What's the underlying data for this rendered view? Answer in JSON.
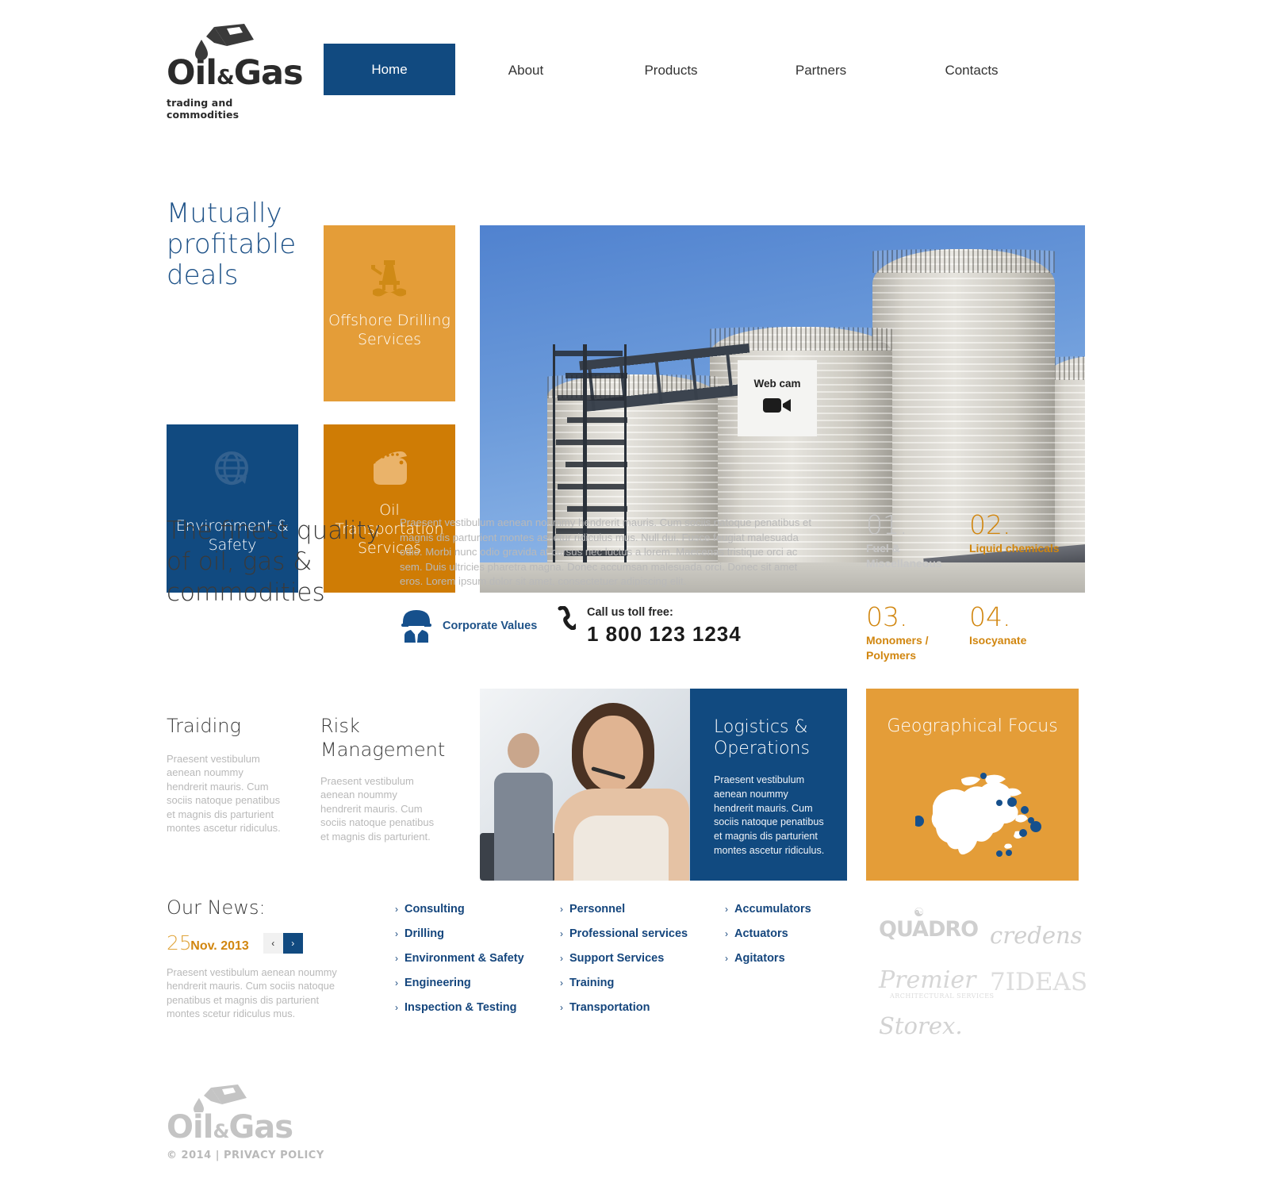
{
  "brand": {
    "name_part1": "Oil",
    "amp": "&",
    "name_part2": "Gas",
    "tagline": "trading and commodities",
    "colors": {
      "blue": "#114a80",
      "orange_light": "#e49d38",
      "orange_dark": "#cf7c05",
      "muted_text": "#b9b9b9"
    }
  },
  "nav": {
    "items": [
      {
        "label": "Home",
        "active": true
      },
      {
        "label": "About",
        "active": false
      },
      {
        "label": "Products",
        "active": false
      },
      {
        "label": "Partners",
        "active": false
      },
      {
        "label": "Contacts",
        "active": false
      }
    ]
  },
  "hero": {
    "headline": "Mutually profitable deals",
    "tiles": [
      {
        "label": "Offshore Drilling Services",
        "icon": "oil-rig-icon",
        "color": "#e49d38"
      },
      {
        "label": "Environment & Safety",
        "icon": "globe-recycle-icon",
        "color": "#114a80"
      },
      {
        "label": "Oil Transportation Services",
        "icon": "ship-icon",
        "color": "#cf7c05"
      }
    ],
    "webcam": {
      "label": "Web cam",
      "icon": "video-camera-icon"
    }
  },
  "quality": {
    "title": "The finest quality of oil, gas & commodities",
    "body": "Praesent vestibulum aenean noummy hendrerit mauris. Cum sociis natoque penatibus et magnis dis parturient montes ascetur ridiculus mus. Null dui. Fusce feugiat malesuada odio. Morbi nunc odio gravida at cursus nec luctus a lorem. Maecenas tristique orci ac sem. Duis ultricies pharetra magna. Donec accumsan malesuada orci. Donec sit amet eros. Lorem ipsum dolor sit amet, consectetuer adipiscing elit.",
    "corporate_values": "Corporate Values",
    "call_label": "Call us toll free:",
    "phone": "1 800 123 1234",
    "products": [
      {
        "num": "01.",
        "label": "Fuel & Miscellaneous",
        "tone": "gray"
      },
      {
        "num": "02.",
        "label": "Liquid chemicals",
        "tone": "orange"
      },
      {
        "num": "03.",
        "label": "Monomers / Polymers",
        "tone": "orange"
      },
      {
        "num": "04.",
        "label": "Isocyanate",
        "tone": "orange"
      }
    ]
  },
  "services": {
    "trading": {
      "title": "Traiding",
      "body": "Praesent vestibulum aenean noummy hendrerit mauris. Cum sociis natoque penatibus et magnis dis parturient montes ascetur ridiculus."
    },
    "risk": {
      "title": "Risk Management",
      "body": "Praesent vestibulum aenean noummy hendrerit mauris. Cum sociis natoque penatibus et magnis dis parturient."
    },
    "logistics": {
      "title": "Logistics & Operations",
      "body": "Praesent vestibulum aenean noummy hendrerit mauris. Cum sociis natoque penatibus et magnis dis parturient montes ascetur ridiculus."
    },
    "geographical": {
      "title": "Geographical Focus"
    }
  },
  "news": {
    "heading": "Our News:",
    "day": "25",
    "month_year": "Nov. 2013",
    "prev_icon": "chevron-left-icon",
    "next_icon": "chevron-right-icon",
    "body": "Praesent vestibulum aenean noummy hendrerit mauris. Cum sociis natoque penatibus et magnis dis parturient montes scetur ridiculus mus."
  },
  "link_columns": [
    {
      "items": [
        "Consulting",
        "Drilling",
        "Environment & Safety",
        "Engineering",
        "Inspection & Testing"
      ]
    },
    {
      "items": [
        "Personnel",
        "Professional services",
        "Support Services",
        "Training",
        "Transportation"
      ]
    },
    {
      "items": [
        "Accumulators",
        "Actuators",
        "Agitators"
      ]
    }
  ],
  "partners": [
    {
      "name": "QUADRO"
    },
    {
      "name": "credens"
    },
    {
      "name": "Premier",
      "sub": "ARCHITECTURAL SERVICES"
    },
    {
      "name": "7IDEAS"
    },
    {
      "name": "Storex."
    }
  ],
  "footer": {
    "name_part1": "Oil",
    "amp": "&",
    "name_part2": "Gas",
    "copyright": "© 2014 | PRIVACY POLICY"
  }
}
